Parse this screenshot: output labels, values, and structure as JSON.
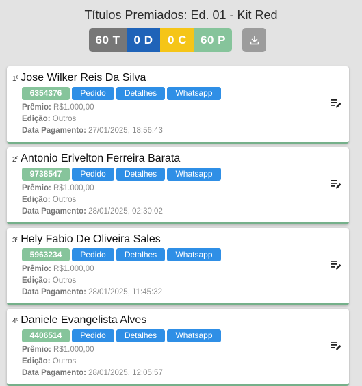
{
  "page": {
    "title": "Títulos Premiados: Ed. 01 - Kit Red"
  },
  "stats": [
    {
      "key": "total",
      "label": "60 T",
      "color": "#777777"
    },
    {
      "key": "d",
      "label": "0 D",
      "color": "#1f63b8"
    },
    {
      "key": "c",
      "label": "0 C",
      "color": "#f5c518"
    },
    {
      "key": "p",
      "label": "60 P",
      "color": "#86c49b"
    }
  ],
  "download": {
    "icon": "download-icon",
    "color": "#9c9c9c"
  },
  "labels": {
    "premio": "Prêmio:",
    "edicao": "Edição:",
    "data_pagamento": "Data Pagamento:",
    "pedido": "Pedido",
    "detalhes": "Detalhes",
    "whatsapp": "Whatsapp"
  },
  "colors": {
    "ticket": "#86c49b",
    "button": "#2f8fe6",
    "accent_border": "#75b08a"
  },
  "winners": [
    {
      "rank": "1º",
      "name": "Jose Wilker Reis Da Silva",
      "ticket": "6354376",
      "premio": "R$1.000,00",
      "edicao": "Outros",
      "data_pagamento": "27/01/2025, 18:56:43"
    },
    {
      "rank": "2º",
      "name": "Antonio Erivelton Ferreira Barata",
      "ticket": "9738547",
      "premio": "R$1.000,00",
      "edicao": "Outros",
      "data_pagamento": "28/01/2025, 02:30:02"
    },
    {
      "rank": "3º",
      "name": "Hely Fabio De Oliveira Sales",
      "ticket": "5963234",
      "premio": "R$1.000,00",
      "edicao": "Outros",
      "data_pagamento": "28/01/2025, 11:45:32"
    },
    {
      "rank": "4º",
      "name": "Daniele Evangelista Alves",
      "ticket": "4406514",
      "premio": "R$1.000,00",
      "edicao": "Outros",
      "data_pagamento": "28/01/2025, 12:05:57"
    }
  ]
}
